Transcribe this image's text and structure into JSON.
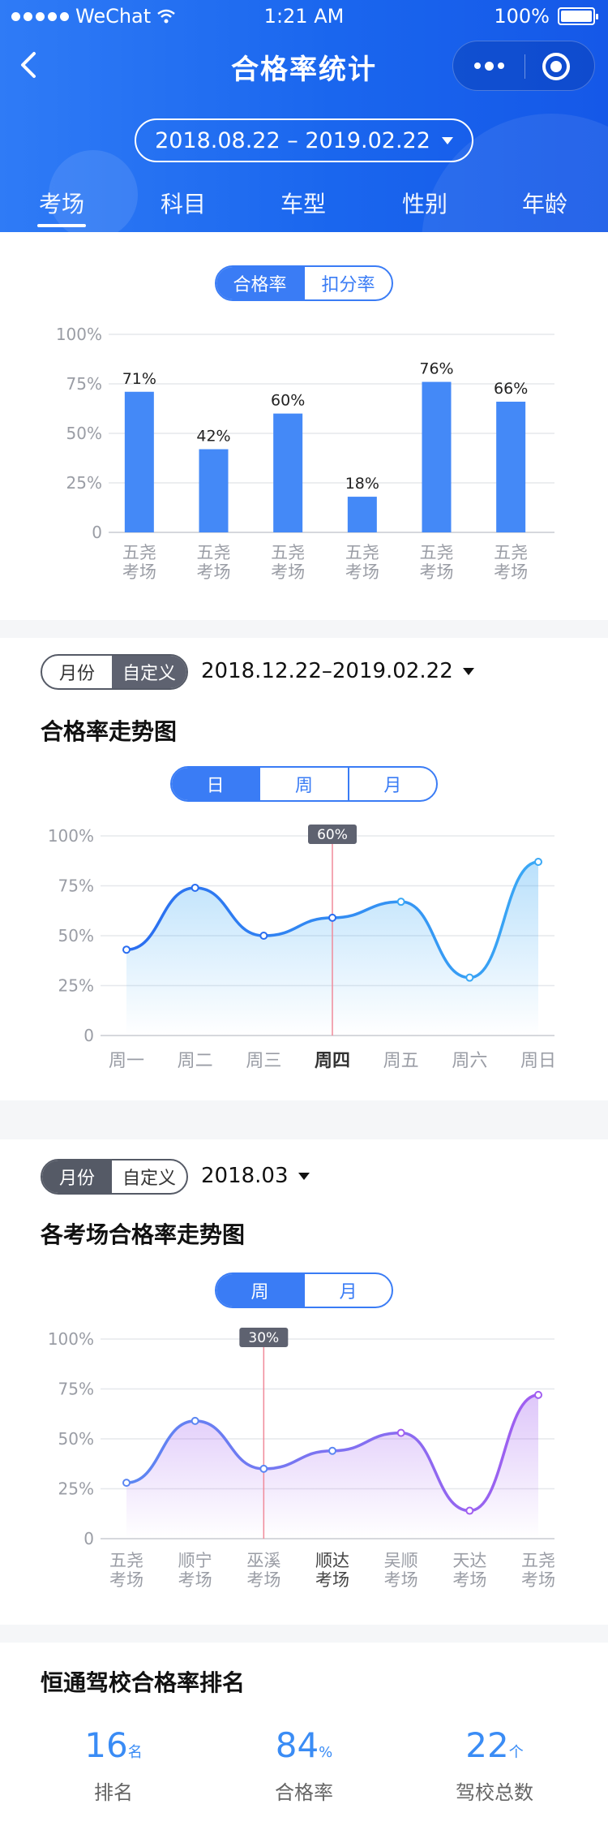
{
  "status": {
    "carrier": "WeChat",
    "time": "1:21 AM",
    "battery": "100%"
  },
  "nav": {
    "title": "合格率统计"
  },
  "date_range": "2018.08.22 – 2019.02.22",
  "tabs": [
    "考场",
    "科目",
    "车型",
    "性别",
    "年龄"
  ],
  "active_tab": "考场",
  "colors": {
    "primary": "#3a7cf5",
    "purple": "#8a5cf0",
    "header": "#1a66ee"
  },
  "bar_section": {
    "segments": [
      "合格率",
      "扣分率"
    ],
    "active_segment": "合格率",
    "chart_data": {
      "type": "bar",
      "categories": [
        "五尧考场",
        "五尧考场",
        "五尧考场",
        "五尧考场",
        "五尧考场",
        "五尧考场"
      ],
      "category_lines": [
        [
          "五尧",
          "考场"
        ],
        [
          "五尧",
          "考场"
        ],
        [
          "五尧",
          "考场"
        ],
        [
          "五尧",
          "考场"
        ],
        [
          "五尧",
          "考场"
        ],
        [
          "五尧",
          "考场"
        ]
      ],
      "values": [
        71,
        42,
        60,
        18,
        76,
        66
      ],
      "data_labels": [
        "71%",
        "42%",
        "60%",
        "18%",
        "76%",
        "66%"
      ],
      "y_ticks": [
        "100%",
        "75%",
        "50%",
        "25%",
        "0"
      ],
      "ylim": [
        0,
        100
      ],
      "grid": true
    }
  },
  "trend_section": {
    "toggle": [
      "月份",
      "自定义"
    ],
    "active_toggle": "自定义",
    "date": "2018.12.22–2019.02.22",
    "title": "合格率走势图",
    "segments": [
      "日",
      "周",
      "月"
    ],
    "active_segment": "日",
    "chart_data": {
      "type": "line",
      "x": [
        "周一",
        "周二",
        "周三",
        "周四",
        "周五",
        "周六",
        "周日"
      ],
      "values": [
        43,
        74,
        50,
        59,
        67,
        29,
        87
      ],
      "highlight_index": 3,
      "highlight_label": "60%",
      "y_ticks": [
        "100%",
        "75%",
        "50%",
        "25%",
        "0"
      ],
      "ylim": [
        0,
        100
      ],
      "grid": true
    }
  },
  "site_trend_section": {
    "toggle": [
      "月份",
      "自定义"
    ],
    "active_toggle": "月份",
    "date": "2018.03",
    "title": "各考场合格率走势图",
    "segments": [
      "周",
      "月"
    ],
    "active_segment": "周",
    "chart_data": {
      "type": "line",
      "x": [
        "五尧考场",
        "顺宁考场",
        "巫溪考场",
        "顺达考场",
        "吴顺考场",
        "天达考场",
        "五尧考场"
      ],
      "x_lines": [
        [
          "五尧",
          "考场"
        ],
        [
          "顺宁",
          "考场"
        ],
        [
          "巫溪",
          "考场"
        ],
        [
          "顺达",
          "考场"
        ],
        [
          "吴顺",
          "考场"
        ],
        [
          "天达",
          "考场"
        ],
        [
          "五尧",
          "考场"
        ]
      ],
      "values": [
        28,
        59,
        35,
        44,
        53,
        14,
        72
      ],
      "highlight_index": 2,
      "highlight_label": "30%",
      "y_ticks": [
        "100%",
        "75%",
        "50%",
        "25%",
        "0"
      ],
      "ylim": [
        0,
        100
      ],
      "grid": true
    }
  },
  "ranking_section": {
    "title": "恒通驾校合格率排名",
    "stats": [
      {
        "value": "16",
        "unit": "名",
        "label": "排名"
      },
      {
        "value": "84",
        "unit": "%",
        "label": "合格率"
      },
      {
        "value": "22",
        "unit": "个",
        "label": "驾校总数"
      }
    ]
  }
}
